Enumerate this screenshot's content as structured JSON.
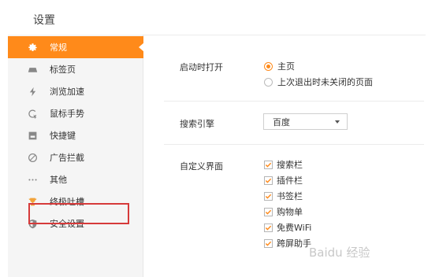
{
  "header": {
    "title": "设置"
  },
  "sidebar": {
    "items": [
      {
        "label": "常规",
        "icon": "gear-icon",
        "active": true
      },
      {
        "label": "标签页",
        "icon": "tab-icon"
      },
      {
        "label": "浏览加速",
        "icon": "lightning-icon"
      },
      {
        "label": "鼠标手势",
        "icon": "mouse-gesture-icon"
      },
      {
        "label": "快捷键",
        "icon": "shortcut-key-icon"
      },
      {
        "label": "广告拦截",
        "icon": "block-icon"
      },
      {
        "label": "其他",
        "icon": "more-dots-icon",
        "highlighted": true
      },
      {
        "label": "终极吐槽",
        "icon": "trophy-icon"
      },
      {
        "label": "安全设置",
        "icon": "shield-icon"
      }
    ]
  },
  "startup": {
    "label": "启动时打开",
    "options": [
      {
        "label": "主页",
        "checked": true
      },
      {
        "label": "上次退出时未关闭的页面",
        "checked": false
      }
    ]
  },
  "search": {
    "label": "搜索引擎",
    "selected": "百度"
  },
  "custom": {
    "label": "自定义界面",
    "options": [
      {
        "label": "搜索栏",
        "checked": true
      },
      {
        "label": "插件栏",
        "checked": true
      },
      {
        "label": "书签栏",
        "checked": true
      },
      {
        "label": "购物单",
        "checked": true
      },
      {
        "label": "免费WiFi",
        "checked": true
      },
      {
        "label": "跨屏助手",
        "checked": true
      }
    ]
  },
  "watermark": "Baidu 经验",
  "colors": {
    "accent": "#ff8a1a",
    "highlight_border": "#d63a3a",
    "check": "#ff8a1a"
  }
}
